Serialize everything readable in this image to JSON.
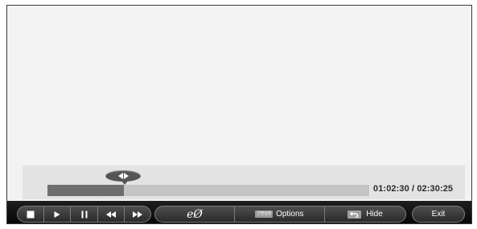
{
  "player": {
    "position": "01:02:30",
    "duration": "02:30:25",
    "time_separator": "/",
    "progress_fraction": 0.2375
  },
  "controls": {
    "transport": [
      {
        "name": "stop-button",
        "icon": "stop-icon"
      },
      {
        "name": "play-button",
        "icon": "play-icon"
      },
      {
        "name": "pause-button",
        "icon": "pause-icon"
      },
      {
        "name": "rewind-button",
        "icon": "rewind-icon"
      },
      {
        "name": "fast-forward-button",
        "icon": "fast-forward-icon"
      }
    ],
    "eco_label": "eØ",
    "options_key_badge": "간편설정",
    "options_label": "Options",
    "hide_label": "Hide",
    "exit_label": "Exit"
  }
}
